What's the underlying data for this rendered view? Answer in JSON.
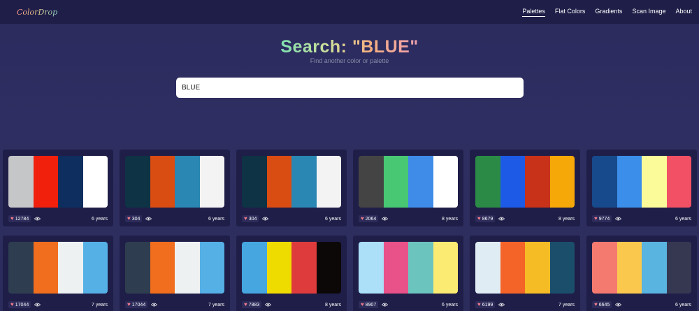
{
  "nav": {
    "logo": "ColorDrop",
    "links": [
      "Palettes",
      "Flat Colors",
      "Gradients",
      "Scan Image",
      "About"
    ]
  },
  "hero": {
    "title": "Search: \"BLUE\"",
    "subtitle": "Find another color or palette",
    "search_value": "BLUE"
  },
  "palettes": [
    {
      "colors": [
        "#c4c6c8",
        "#f0200d",
        "#0d2e5e",
        "#ffffff"
      ],
      "likes": "12784",
      "age": "6 years"
    },
    {
      "colors": [
        "#0d3344",
        "#d94c12",
        "#2a86b2",
        "#f3f3f3"
      ],
      "likes": "304",
      "age": "6 years"
    },
    {
      "colors": [
        "#0d3344",
        "#d94c12",
        "#2a86b2",
        "#f3f3f3"
      ],
      "likes": "304",
      "age": "6 years"
    },
    {
      "colors": [
        "#444444",
        "#49c873",
        "#3e8ce8",
        "#ffffff"
      ],
      "likes": "2064",
      "age": "8 years"
    },
    {
      "colors": [
        "#2b8a45",
        "#1d5ae6",
        "#c83219",
        "#f5a807"
      ],
      "likes": "8679",
      "age": "8 years"
    },
    {
      "colors": [
        "#174a8c",
        "#3b8fea",
        "#fbfb9a",
        "#f25064"
      ],
      "likes": "9774",
      "age": "6 years"
    },
    {
      "colors": [
        "#2e3e50",
        "#f06e1e",
        "#eef1f2",
        "#55b0e6"
      ],
      "likes": "17044",
      "age": "7 years"
    },
    {
      "colors": [
        "#2e3e50",
        "#f06e1e",
        "#eef1f2",
        "#55b0e6"
      ],
      "likes": "17044",
      "age": "7 years"
    },
    {
      "colors": [
        "#45a6e0",
        "#eedb00",
        "#de3c3c",
        "#0c0808"
      ],
      "likes": "7883",
      "age": "8 years"
    },
    {
      "colors": [
        "#ace0f8",
        "#e85288",
        "#6cc4be",
        "#fbeb72"
      ],
      "likes": "8907",
      "age": "6 years"
    },
    {
      "colors": [
        "#e0ecf3",
        "#f46428",
        "#f5bc26",
        "#1a4e6a"
      ],
      "likes": "6199",
      "age": "7 years"
    },
    {
      "colors": [
        "#f47a70",
        "#fbc84e",
        "#5ab4e0",
        "#363852"
      ],
      "likes": "6645",
      "age": "6 years"
    }
  ]
}
